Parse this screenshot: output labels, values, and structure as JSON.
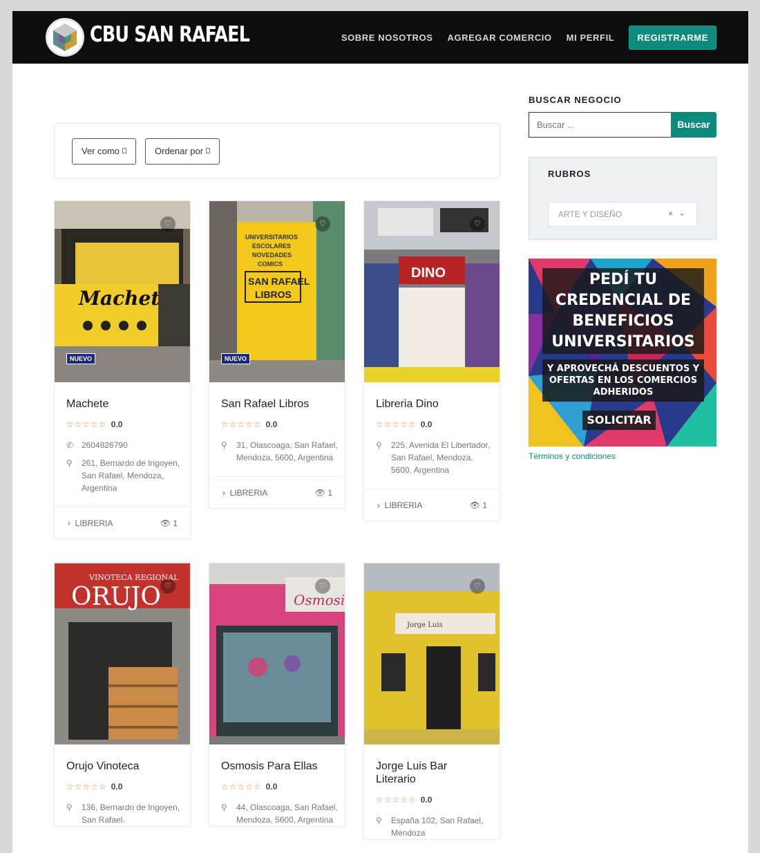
{
  "brand": {
    "name": "CBU SAN RAFAEL"
  },
  "nav": {
    "items": [
      "SOBRE NOSOTROS",
      "AGREGAR COMERCIO",
      "MI PERFIL"
    ],
    "register": "REGISTRARME"
  },
  "filters": {
    "view_as": "Ver como",
    "sort_by": "Ordenar por"
  },
  "listings": [
    {
      "name": "Machete",
      "rating": "0.0",
      "badge": "NUEVO",
      "phone": "2604826790",
      "address": "261, Bernardo de Irigoyen, San Rafael, Mendoza, Argentina",
      "category": "LIBRERIA",
      "views": "1"
    },
    {
      "name": "San Rafael Libros",
      "rating": "0.0",
      "badge": "NUEVO",
      "address": "31, Olascoaga, San Rafael, Mendoza, 5600, Argentina",
      "category": "LIBRERIA",
      "views": "1"
    },
    {
      "name": "Libreria Dino",
      "rating": "0.0",
      "address": "225, Avenida El Libertador, San Rafael, Mendoza, 5600, Argentina",
      "category": "LIBRERIA",
      "views": "1"
    },
    {
      "name": "Orujo Vinoteca",
      "rating": "0.0",
      "address": "136, Bernardo de Irigoyen, San Rafael."
    },
    {
      "name": "Osmosis Para Ellas",
      "rating": "0.0",
      "address": "44, Olascoaga, San Rafael, Mendoza, 5600, Argentina"
    },
    {
      "name": "Jorge Luis Bar Literario",
      "rating": "0.0",
      "address": "España 102, San Rafael, Mendoza"
    }
  ],
  "sidebar": {
    "search_title": "BUSCAR NEGOCIO",
    "search_placeholder": "Buscar ...",
    "search_button": "Buscar",
    "rubros_title": "RUBROS",
    "rubros_selected": "ARTE Y DISEÑO",
    "promo": {
      "headline": "PEDÍ TU CREDENCIAL DE BENEFICIOS UNIVERSITARIOS",
      "sub": "Y APROVECHÁ DESCUENTOS Y OFERTAS EN LOS COMERCIOS ADHERIDOS",
      "cta": "SOLICITAR"
    },
    "terms": "Términos y condiciones"
  },
  "icons": {
    "heart": "heart-icon",
    "phone": "phone-icon",
    "pin": "map-pin-icon",
    "chevron": "chevron-right-icon",
    "eye": "eye-icon",
    "star": "star-outline-icon"
  },
  "colors": {
    "accent": "#0d8a7c",
    "header": "#0d0d0d",
    "stars": "#e5833a",
    "badge": "#1b2b7a"
  }
}
